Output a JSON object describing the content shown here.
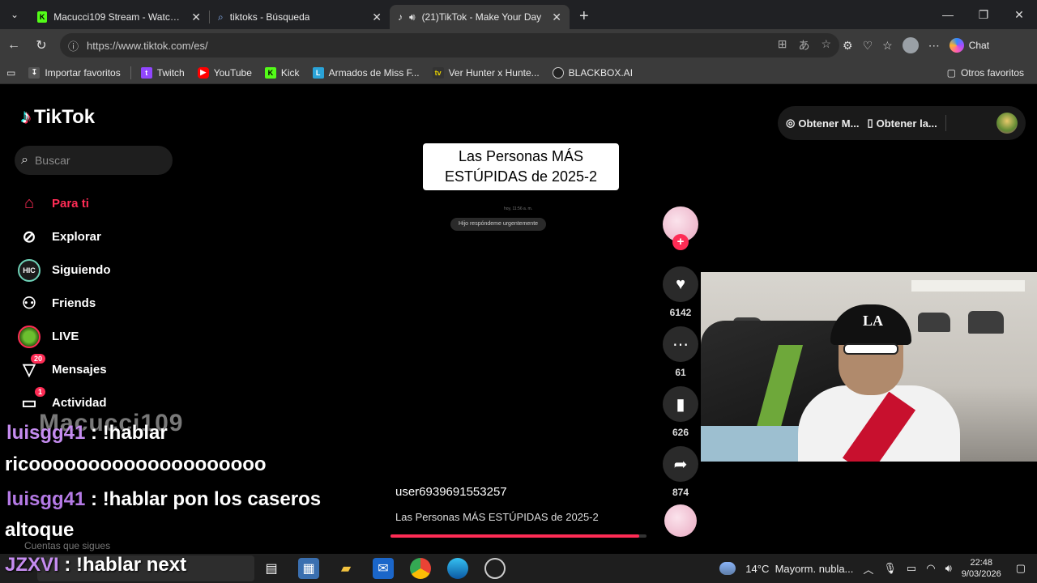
{
  "browser": {
    "tabs": [
      {
        "title": "Macucci109 Stream - Watch Live o",
        "icon_color": "#53fc18"
      },
      {
        "title": "tiktoks - Búsqueda",
        "icon_color": "#5a8dee"
      },
      {
        "title": "(21)TikTok - Make Your Day",
        "icon_color": "#ffffff"
      }
    ],
    "url": "https://www.tiktok.com/es/",
    "chat_label": "Chat",
    "bookmarks": [
      {
        "label": "Importar favoritos",
        "color": "#888888"
      },
      {
        "label": "Twitch",
        "color": "#9146ff"
      },
      {
        "label": "YouTube",
        "color": "#ff0000"
      },
      {
        "label": "Kick",
        "color": "#53fc18"
      },
      {
        "label": "Armados de Miss F...",
        "color": "#2aa3d8"
      },
      {
        "label": "Ver Hunter x Hunte...",
        "color": "#333333"
      },
      {
        "label": "BLACKBOX.AI",
        "color": "#222222"
      }
    ],
    "other_favorites": "Otros favoritos"
  },
  "tiktok": {
    "logo": "TikTok",
    "search_placeholder": "Buscar",
    "nav": [
      {
        "label": "Para ti",
        "icon": "home-icon"
      },
      {
        "label": "Explorar",
        "icon": "compass-icon"
      },
      {
        "label": "Siguiendo",
        "icon": "following-icon"
      },
      {
        "label": "Friends",
        "icon": "friends-icon"
      },
      {
        "label": "LIVE",
        "icon": "live-icon"
      },
      {
        "label": "Mensajes",
        "icon": "messages-icon",
        "badge": "20"
      },
      {
        "label": "Actividad",
        "icon": "activity-icon",
        "badge": "1"
      }
    ],
    "following_accounts": "Cuentas que sigues",
    "top_bar": {
      "get_coins": "Obtener M...",
      "get_app": "Obtener la..."
    },
    "video": {
      "title_line1": "Las Personas MÁS",
      "title_line2": "ESTÚPIDAS de 2025-2",
      "bubble_time": "hoy, 11:56 a. m.",
      "bubble_text": "Hijo respóndeme urgentemente",
      "username": "user6939691553257",
      "description": "Las Personas MÁS ESTÚPIDAS de 2025-2",
      "progress": 0.97
    },
    "actions": {
      "likes": "6142",
      "comments": "61",
      "saves": "626",
      "shares": "874"
    }
  },
  "stream_overlay": {
    "watermark": "Macucci109",
    "messages": [
      {
        "user": "luisgg41",
        "text": " : !hablar"
      },
      {
        "user": "",
        "text": "ricoooooooooooooooooooo"
      },
      {
        "user": "luisgg41",
        "text": " : !hablar pon los caseros"
      },
      {
        "user": "",
        "text": "altoque"
      },
      {
        "user": "JZXVI",
        "text": " : !hablar next"
      }
    ]
  },
  "taskbar": {
    "weather": "14°C  Mayorm. nubla...",
    "time": "22:48",
    "date": "9/03/2026"
  }
}
